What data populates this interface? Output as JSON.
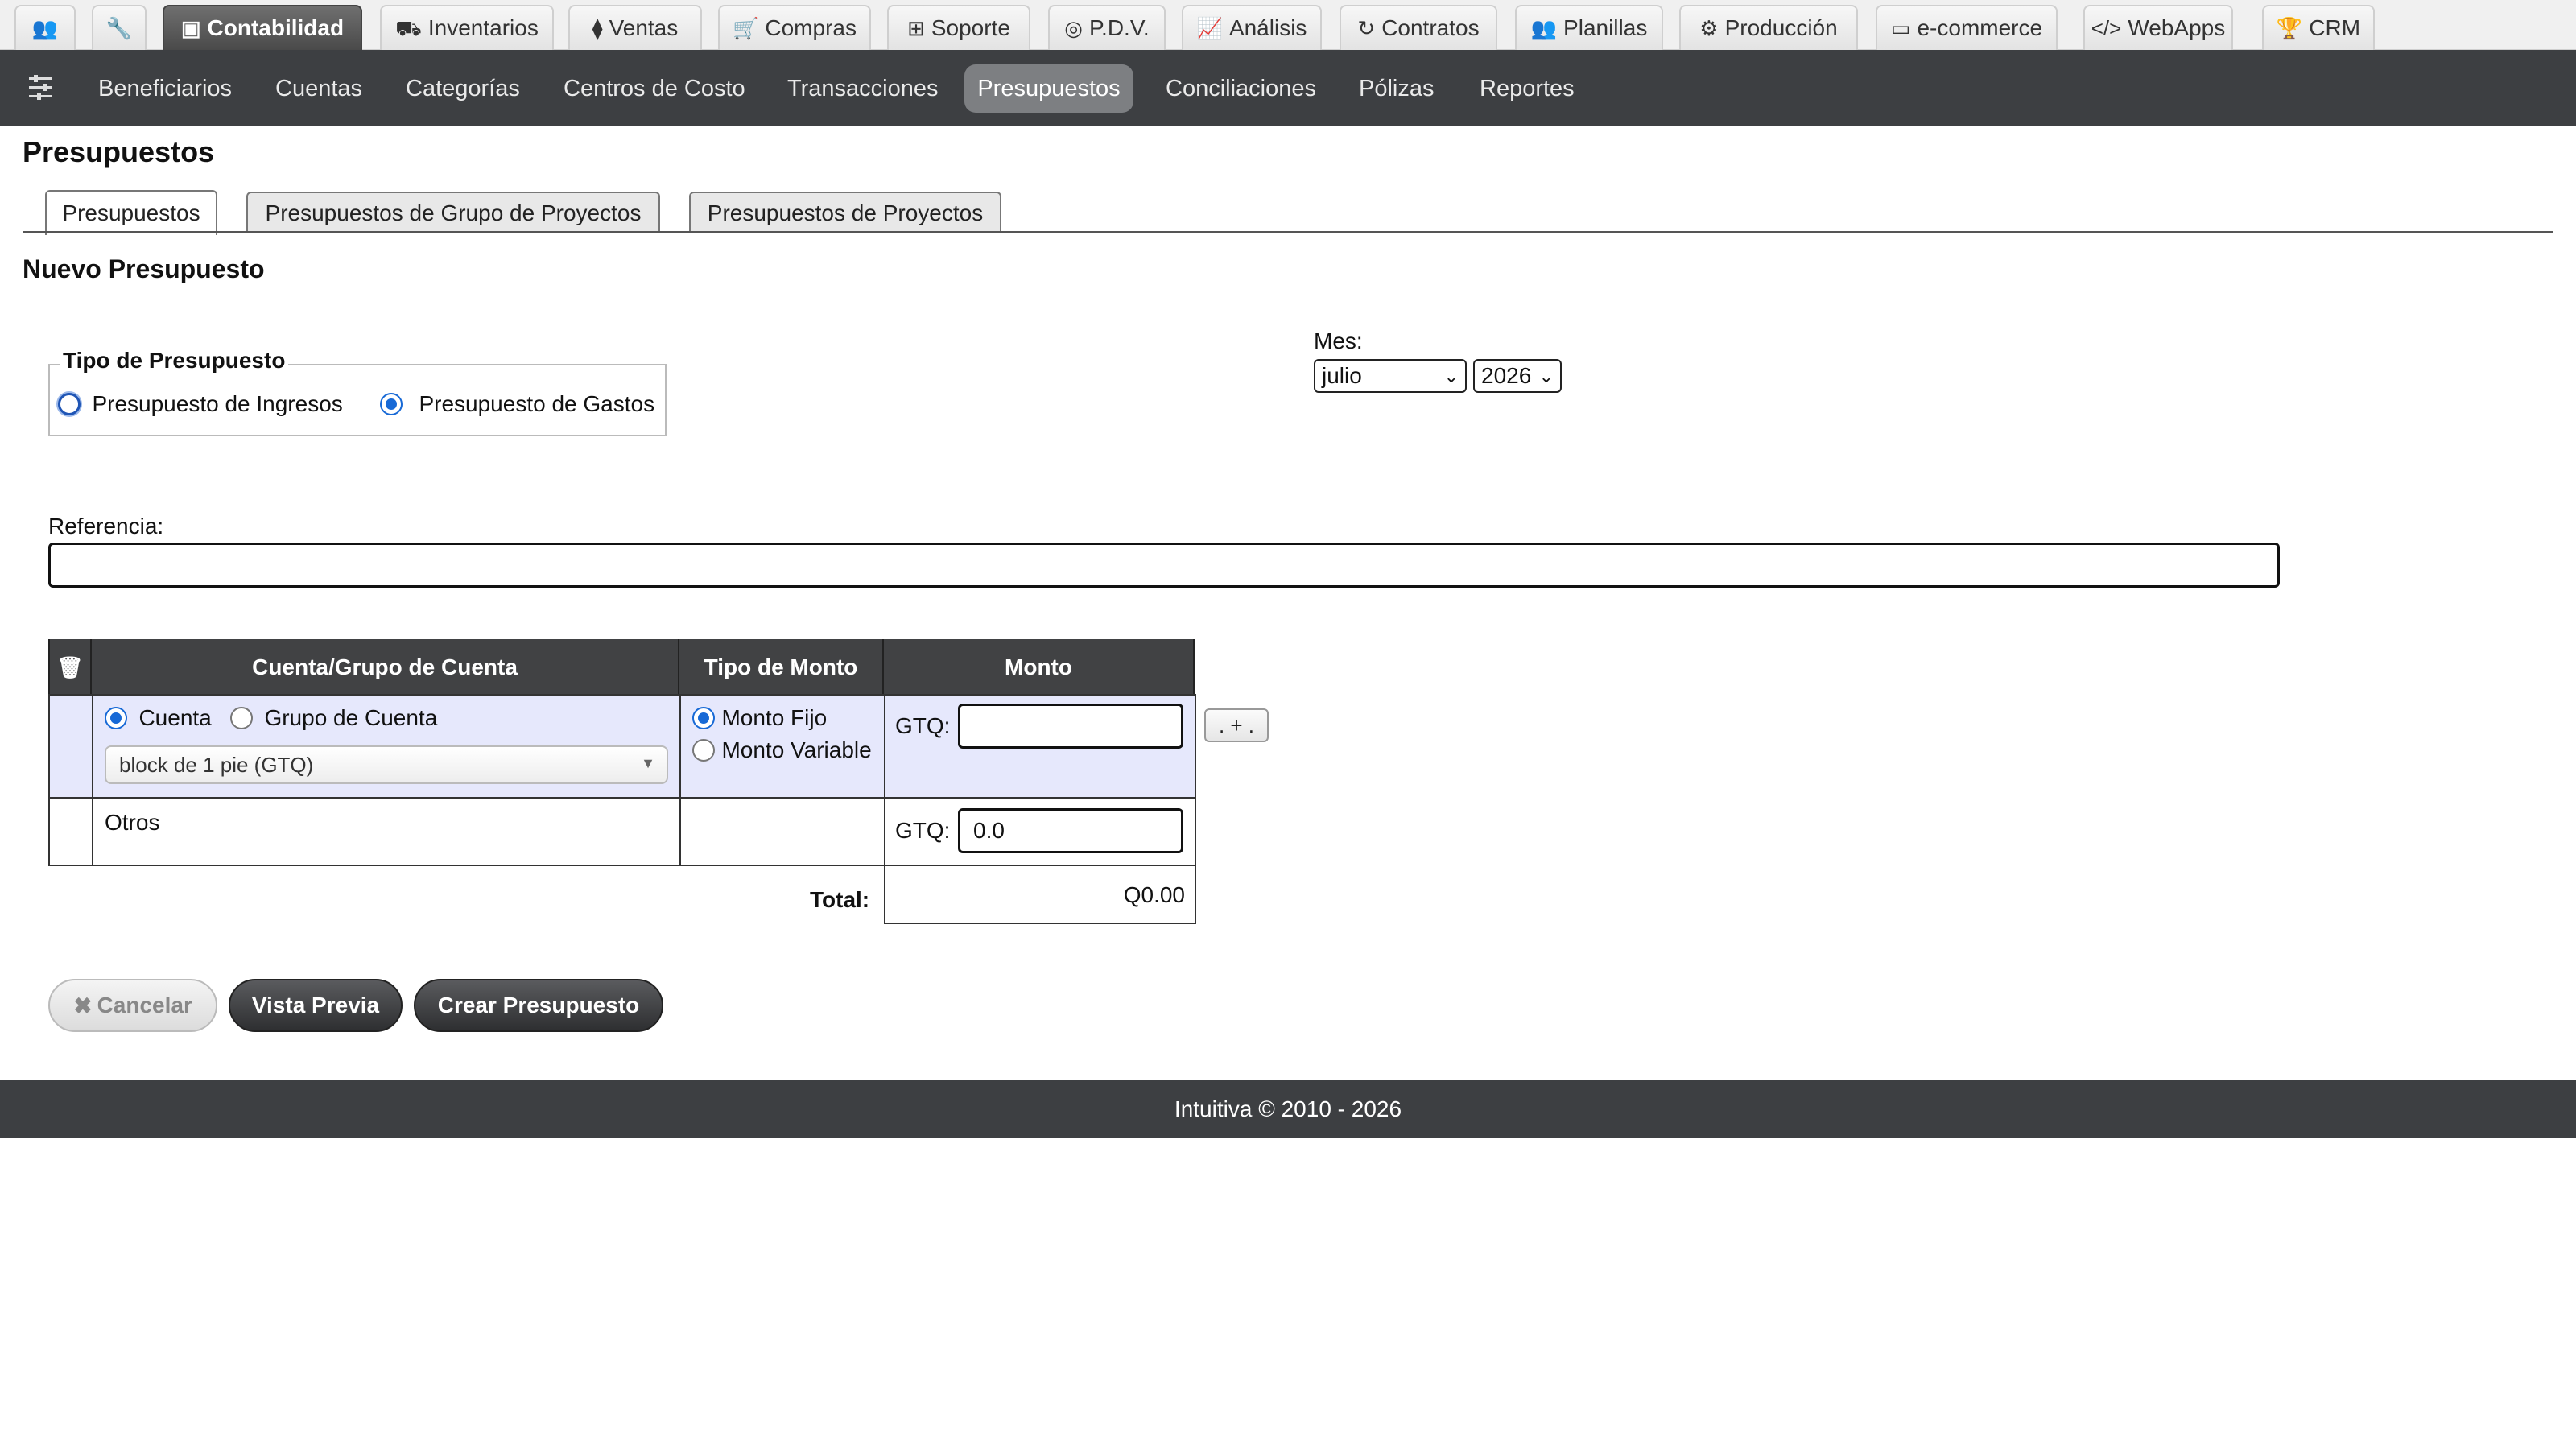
{
  "modules": [
    {
      "label": "",
      "icon": "users-icon"
    },
    {
      "label": "",
      "icon": "wrench-icon"
    },
    {
      "label": "Contabilidad",
      "icon": "money-icon"
    },
    {
      "label": "Inventarios",
      "icon": "truck-icon"
    },
    {
      "label": "Ventas",
      "icon": "tag-icon"
    },
    {
      "label": "Compras",
      "icon": "cart-icon"
    },
    {
      "label": "Soporte",
      "icon": "medkit-icon"
    },
    {
      "label": "P.D.V.",
      "icon": "target-icon"
    },
    {
      "label": "Análisis",
      "icon": "chart-icon"
    },
    {
      "label": "Contratos",
      "icon": "refresh-icon"
    },
    {
      "label": "Planillas",
      "icon": "group-icon"
    },
    {
      "label": "Producción",
      "icon": "cogs-icon"
    },
    {
      "label": "e-commerce",
      "icon": "credit-card-icon"
    },
    {
      "label": "WebApps",
      "icon": "code-icon"
    },
    {
      "label": "CRM",
      "icon": "trophy-icon"
    }
  ],
  "subnav": [
    "Beneficiarios",
    "Cuentas",
    "Categorías",
    "Centros de Costo",
    "Transacciones",
    "Presupuestos",
    "Conciliaciones",
    "Pólizas",
    "Reportes"
  ],
  "page": {
    "title": "Presupuestos",
    "tabs": [
      "Presupuestos",
      "Presupuestos de Grupo de Proyectos",
      "Presupuestos de Proyectos"
    ],
    "section_title": "Nuevo Presupuesto"
  },
  "budget_type": {
    "legend": "Tipo de Presupuesto",
    "income_label": "Presupuesto de Ingresos",
    "expense_label": "Presupuesto de Gastos",
    "selected": "expense"
  },
  "month": {
    "label": "Mes:",
    "month_value": "julio",
    "year_value": "2026"
  },
  "reference": {
    "label": "Referencia:",
    "value": ""
  },
  "table": {
    "headers": [
      "Cuenta/Grupo de Cuenta",
      "Tipo de Monto",
      "Monto"
    ],
    "row1": {
      "account_label": "Cuenta",
      "group_label": "Grupo de Cuenta",
      "account_value": "block de 1 pie (GTQ)",
      "fixed_label": "Monto Fijo",
      "variable_label": "Monto Variable",
      "currency_label": "GTQ:",
      "amount": ""
    },
    "row2": {
      "label": "Otros",
      "currency_label": "GTQ:",
      "amount": "0.0"
    },
    "total_label": "Total:",
    "total_value": "Q0.00",
    "add_button": ". + ."
  },
  "buttons": {
    "cancel": "Cancelar",
    "preview": "Vista Previa",
    "create": "Crear Presupuesto"
  },
  "footer": "Intuitiva © 2010 - 2026"
}
